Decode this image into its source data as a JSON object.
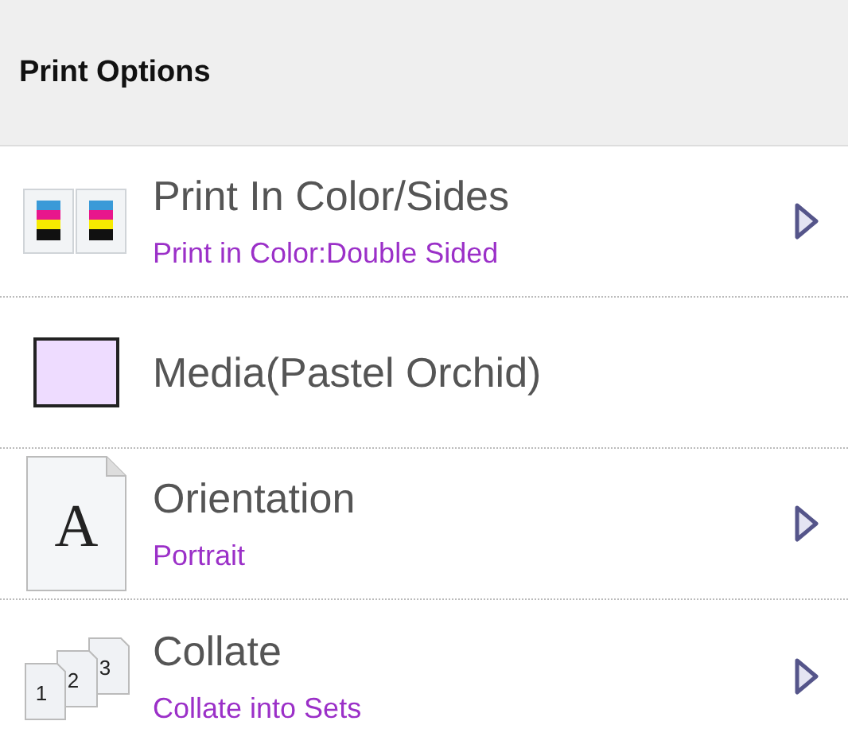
{
  "header": {
    "title": "Print Options"
  },
  "options": [
    {
      "kind": "color-sides",
      "title": "Print In Color/Sides",
      "value": "Print in Color:Double Sided",
      "submenu": true
    },
    {
      "kind": "swatch",
      "title": "Media(Pastel Orchid)",
      "color": "#eedcff",
      "submenu": false
    },
    {
      "kind": "orientation",
      "title": "Orientation",
      "value": "Portrait",
      "icon_text": [
        "A"
      ],
      "submenu": true
    },
    {
      "kind": "collate",
      "title": "Collate",
      "value": "Collate into Sets",
      "icon_text": [
        "1",
        "2",
        "3"
      ],
      "submenu": true
    }
  ]
}
